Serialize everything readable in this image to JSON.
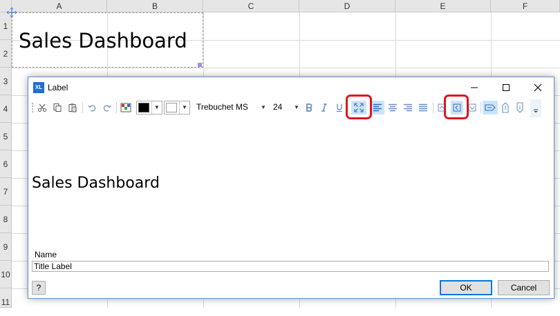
{
  "sheet": {
    "columns": [
      "A",
      "B",
      "C",
      "D",
      "E",
      "F"
    ],
    "rows": [
      "1",
      "2",
      "3",
      "4",
      "5",
      "6",
      "7",
      "8",
      "9",
      "10",
      "11"
    ],
    "title_cell": "Sales Dashboard"
  },
  "dialog": {
    "app_icon": "XL",
    "title": "Label",
    "toolbar": {
      "font_name": "Trebuchet MS",
      "font_size": "24",
      "text_color": "#000000",
      "fill_color": "#ffffff",
      "icons": [
        "cut-icon",
        "copy-icon",
        "paste-icon",
        "undo-icon",
        "redo-icon",
        "format-cells-icon",
        "bold-icon",
        "italic-icon",
        "underline-icon",
        "fit-text-icon",
        "align-left-icon",
        "align-center-icon",
        "align-right-icon",
        "justify-icon",
        "valign-top-icon",
        "valign-middle-icon",
        "valign-bottom-icon",
        "text-direction-icon",
        "rotate-up-icon",
        "rotate-down-icon",
        "overflow-icon"
      ],
      "highlight_color": "#e0141e"
    },
    "preview_text": "Sales Dashboard",
    "name_label": "Name",
    "name_value": "Title Label",
    "help_label": "?",
    "ok_label": "OK",
    "cancel_label": "Cancel"
  }
}
